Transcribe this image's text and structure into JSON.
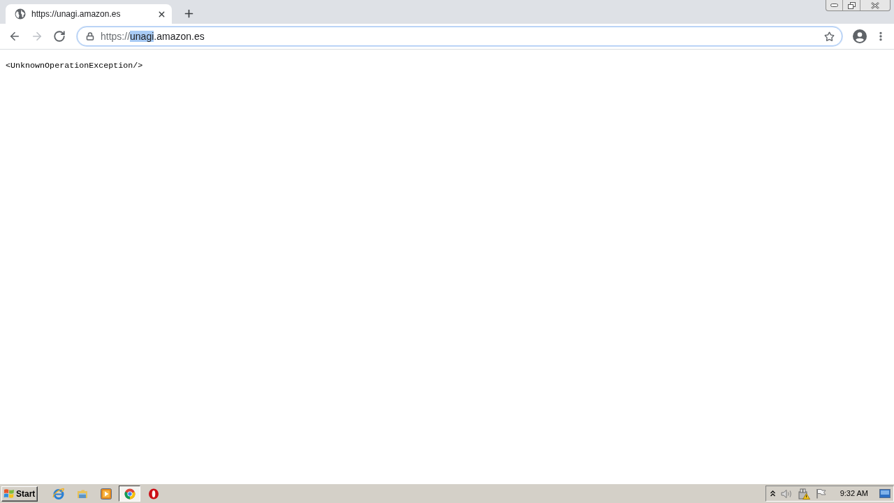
{
  "tabs": [
    {
      "title": "https://unagi.amazon.es",
      "selected": true
    }
  ],
  "nav_buttons": [
    {
      "kind": "back",
      "disabled": false
    },
    {
      "kind": "forward",
      "disabled": true
    },
    {
      "kind": "reload",
      "disabled": false
    }
  ],
  "address_bar": {
    "segments": [
      {
        "text": "https://",
        "kind": "scheme",
        "selected": false
      },
      {
        "text": "unagi",
        "kind": "host",
        "selected": true
      },
      {
        "text": ".amazon.es",
        "kind": "host",
        "selected": false
      }
    ]
  },
  "page": {
    "text": "<UnknownOperationException/>"
  },
  "taskbar": {
    "start_label": "Start",
    "apps": [
      {
        "kind": "ie",
        "selected": false
      },
      {
        "kind": "folder",
        "selected": false
      },
      {
        "kind": "media",
        "selected": false
      },
      {
        "kind": "chrome",
        "selected": true
      },
      {
        "kind": "opera",
        "selected": false
      }
    ],
    "tray": [
      {
        "kind": "chevron"
      },
      {
        "kind": "speaker"
      },
      {
        "kind": "network"
      },
      {
        "kind": "flag"
      }
    ],
    "clock": "9:32 AM"
  }
}
